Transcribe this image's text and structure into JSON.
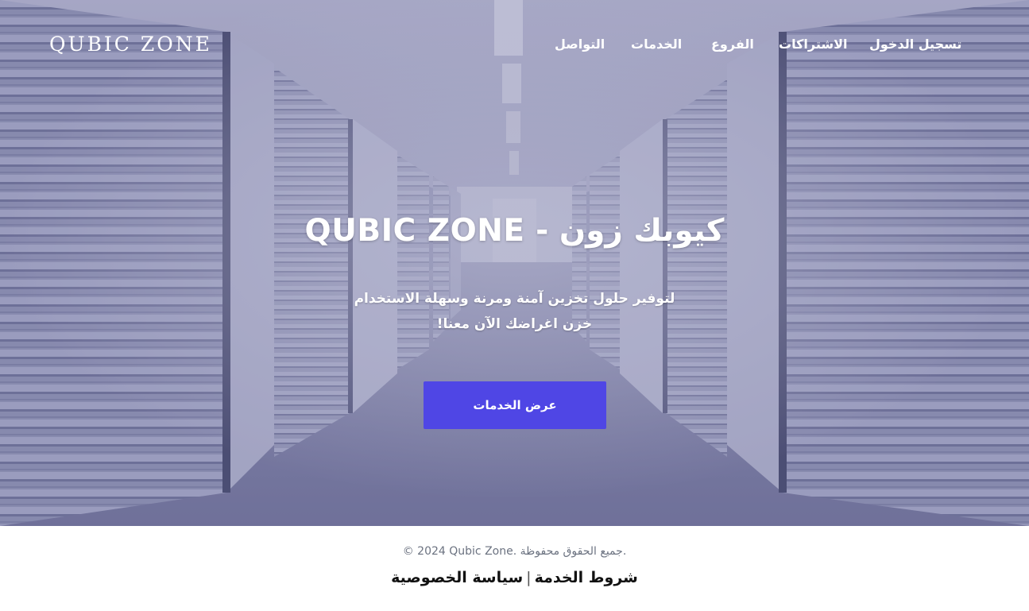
{
  "header": {
    "brand": "QUBIC ZONE",
    "nav": [
      {
        "label": "تسجيل الدخول"
      },
      {
        "label": "الاشتراكات"
      },
      {
        "label": "الفروع"
      },
      {
        "label": "الخدمات"
      },
      {
        "label": "التواصل"
      }
    ]
  },
  "hero": {
    "title": "كيوبك زون - QUBIC ZONE",
    "subtitle_line1": "لتوفير حلول تخزين آمنة ومرنة وسهلة الاستخدام",
    "subtitle_line2": "خزن اغراضك الآن معنا!",
    "cta_label": "عرض الخدمات",
    "background": "storage-corridor-image",
    "overlay_color": "#4a4c80"
  },
  "footer": {
    "copyright": "© 2024 Qubic Zone. جميع الحقوق محفوظة.",
    "terms_label": "شروط الخدمة",
    "separator": "|",
    "privacy_label": "سياسة الخصوصية"
  },
  "colors": {
    "accent": "#4f46e5",
    "footer_text": "#6b7280"
  }
}
